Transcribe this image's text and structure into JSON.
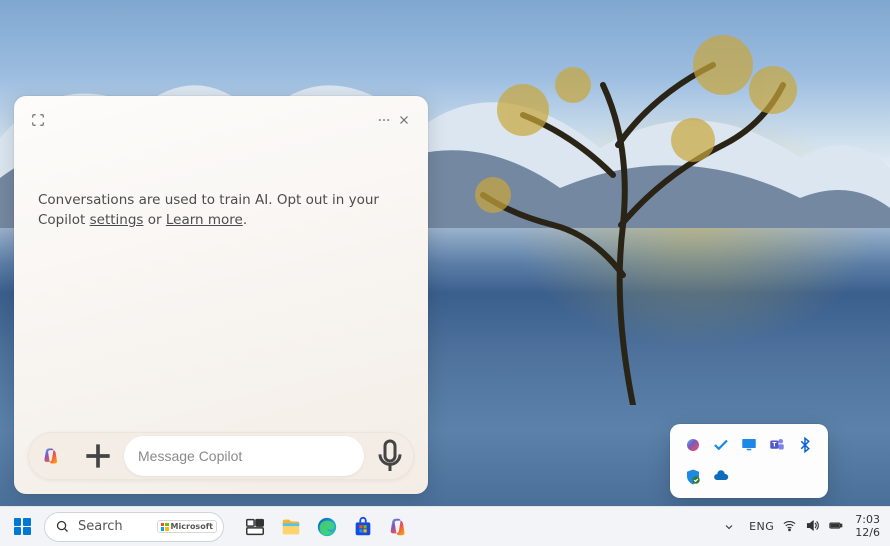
{
  "copilot": {
    "notice_text_1": "Conversations are used to train AI. Opt out in your Copilot ",
    "settings_link": "settings",
    "notice_text_2": " or ",
    "learnmore_link": "Learn more",
    "notice_text_3": ".",
    "input_placeholder": "Message Copilot"
  },
  "taskbar": {
    "search_label": "Search",
    "ms_badge": "Microsoft",
    "lang": "ENG",
    "time": "7:03",
    "date": "12/6"
  },
  "tray_icons": [
    "copilot-icon",
    "checkmark-icon",
    "monitor-icon",
    "teams-icon",
    "bluetooth-icon",
    "security-shield-icon",
    "onedrive-icon"
  ],
  "app_icons": [
    "task-view-icon",
    "file-explorer-icon",
    "edge-icon",
    "microsoft-store-icon",
    "copilot-icon"
  ],
  "colors": {
    "accent": "#0078d4",
    "window_bg": "#f7f3ef"
  }
}
